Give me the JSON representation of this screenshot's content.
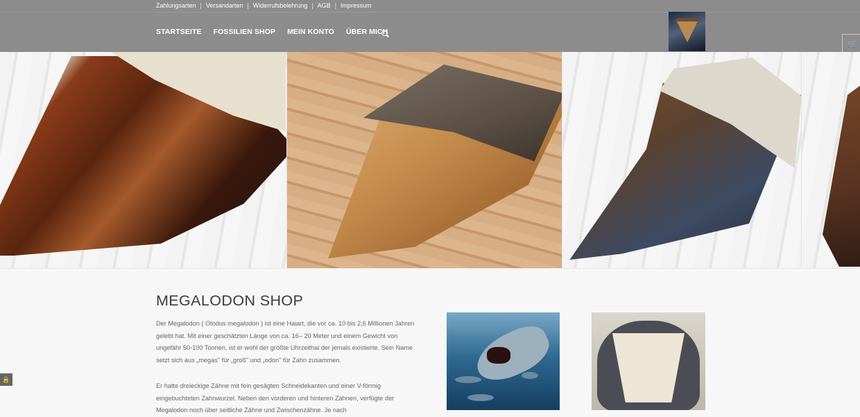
{
  "topbar": {
    "links": [
      "Zahlungsarten",
      "Versandarten",
      "Widerrufsbelehrung",
      "AGB",
      "Impressum"
    ]
  },
  "nav": {
    "items": [
      "STARTSEITE",
      "FOSSILIEN SHOP",
      "MEIN KONTO",
      "ÜBER MICH"
    ],
    "active": "STARTSEITE"
  },
  "icons": {
    "search": "search-icon",
    "cart": "cart-icon",
    "lock": "lock-icon"
  },
  "colors": {
    "header_bg": "#8c8c8c",
    "active_indicator": "#5f8fc0",
    "body_bg": "#f7f7f7",
    "heading": "#3b3b3b",
    "text": "#666666"
  },
  "content": {
    "title": "MEGALODON SHOP",
    "paragraph1": "Der Megalodon ( Otodus megalodon ) ist eine Haiart, die vor ca. 10 bis 2,6 Millionen Jahren gelebt hat. Mit einer geschätzten Länge von ca. 16– 20 Meter und einem Gewicht von ungefähr 50-100 Tonnen, ist er wohl der größte Uhrzeithai der jemals existierte. Sein Name setzt sich aus „megas\" für „groß\" und „odon\" für Zahn zusammen.",
    "paragraph2": "Er hatte dreieckige Zähne mit fein gesägten Schneidekanten und einer V-förmig eingebuchteten Zahnwurzel. Neben den vorderen und hinteren Zähnen, verfügte der Megalodon noch über seitliche Zähne und Zwischenzähne. Je nach"
  }
}
